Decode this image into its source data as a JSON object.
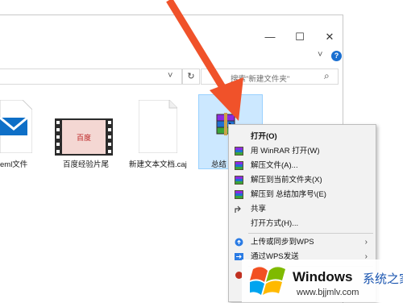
{
  "window": {
    "minimize_glyph": "—",
    "maximize_glyph": "☐",
    "close_glyph": "✕",
    "expand_glyph": "˅",
    "help_glyph": "?"
  },
  "address_bar": {
    "dropdown_glyph": "˅",
    "refresh_glyph": "↻"
  },
  "search": {
    "placeholder": "搜索\"新建文件夹\"",
    "icon_glyph": "⌕"
  },
  "files": [
    {
      "label": "eml文件",
      "icon": "mail-icon"
    },
    {
      "label": "百度经验片尾",
      "icon": "video-icon"
    },
    {
      "label": "新建文本文档.caj",
      "icon": "document-icon"
    },
    {
      "label": "总结",
      "icon": "winrar-archive-icon"
    }
  ],
  "context_menu": {
    "items": [
      {
        "label": "打开(O)",
        "bold": true
      },
      {
        "label": "用 WinRAR 打开(W)"
      },
      {
        "label": "解压文件(A)..."
      },
      {
        "label": "解压到当前文件夹(X)"
      },
      {
        "label": "解压到 总结加序号\\(E)"
      },
      {
        "label": "共享"
      },
      {
        "label": "打开方式(H)..."
      },
      {
        "label": "上传或同步到WPS"
      },
      {
        "label": "通过WPS发送"
      }
    ],
    "submenu_arrow": "›"
  },
  "watermark": {
    "brand": "Windows",
    "brand_cn": "系统之家",
    "url": "www.bjjmlv.com"
  },
  "colors": {
    "selection": "#cce8ff",
    "menu_bg": "#f2f2f2",
    "annotation_arrow": "#f0522a",
    "help_blue": "#1a6fd0"
  }
}
